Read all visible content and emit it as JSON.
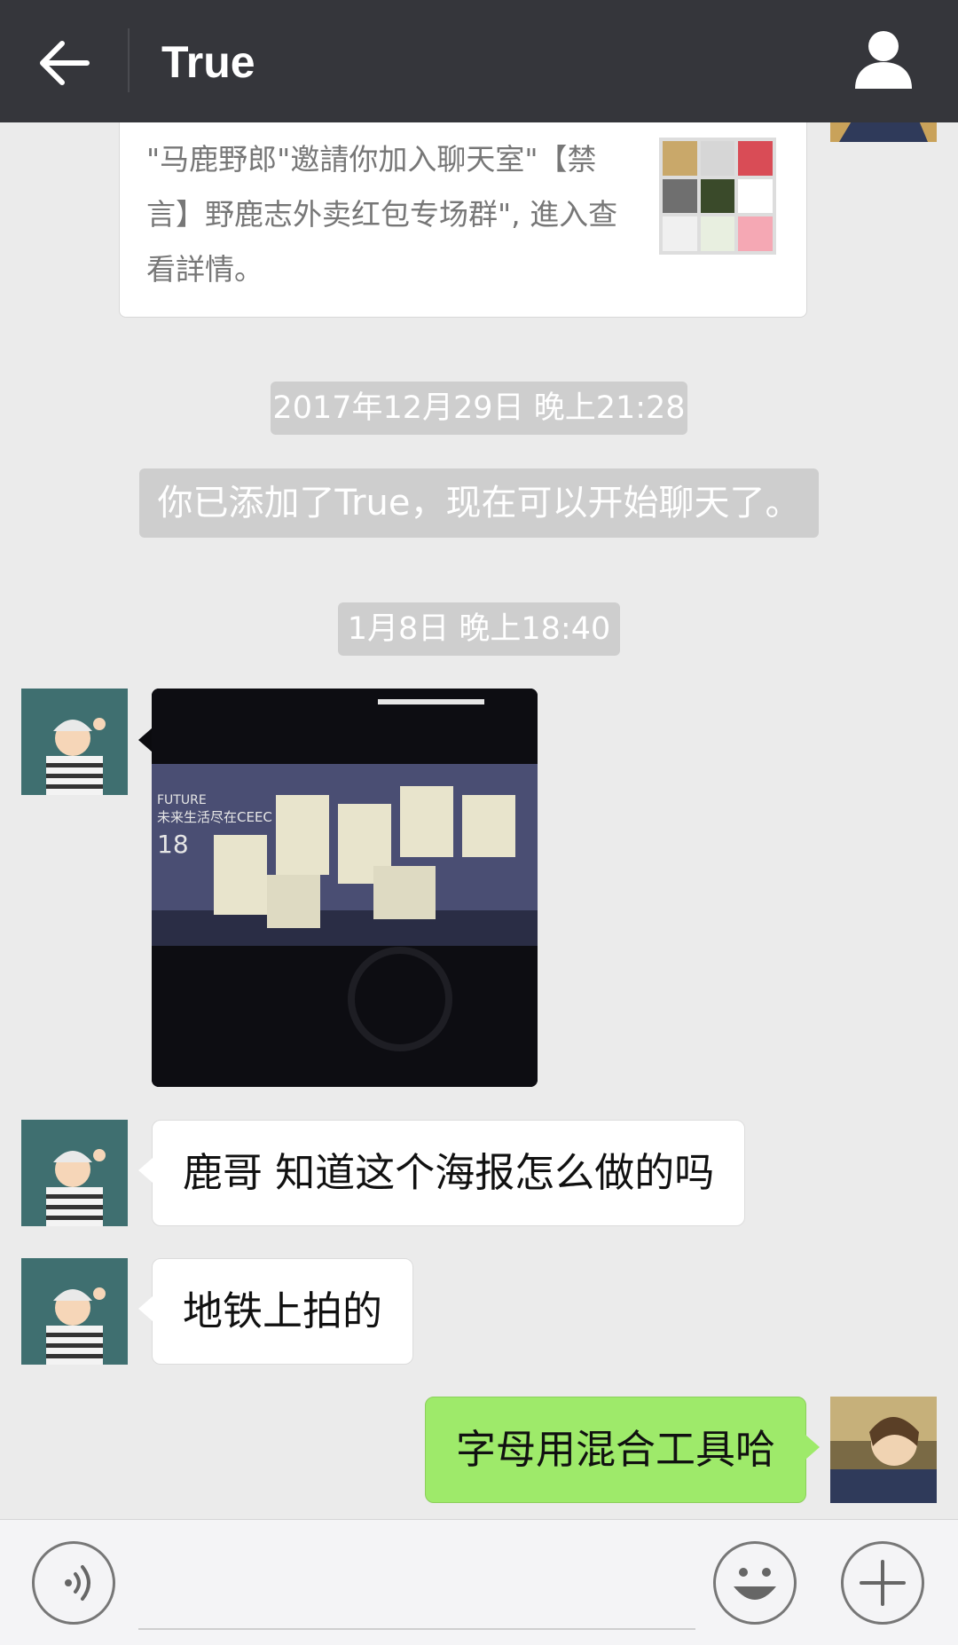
{
  "header": {
    "title": "True",
    "back_icon": "arrow-left-icon",
    "profile_icon": "person-icon"
  },
  "invite_card": {
    "text": "\"马鹿野郎\"邀請你加入聊天室\"【禁言】野鹿志外卖红包专场群\", 進入查看詳情。"
  },
  "timestamps": {
    "first": "2017年12月29日 晚上21:28",
    "second": "1月8日 晚上18:40"
  },
  "system_message": "你已添加了True，现在可以开始聊天了。",
  "messages": [
    {
      "from": "other",
      "type": "image",
      "image_text": "FUTURE 未来生活尽在CEEC 18"
    },
    {
      "from": "other",
      "type": "text",
      "text": "鹿哥 知道这个海报怎么做的吗"
    },
    {
      "from": "other",
      "type": "text",
      "text": "地铁上拍的"
    },
    {
      "from": "me",
      "type": "text",
      "text": "字母用混合工具哈"
    }
  ],
  "bottom_bar": {
    "voice_icon": "voice-icon",
    "emoji_icon": "emoji-icon",
    "plus_icon": "plus-icon",
    "input_value": ""
  },
  "colors": {
    "header_bg": "#35363b",
    "chat_bg": "#ebebeb",
    "my_bubble": "#9eea6a",
    "timestamp_pill": "#cecece"
  }
}
